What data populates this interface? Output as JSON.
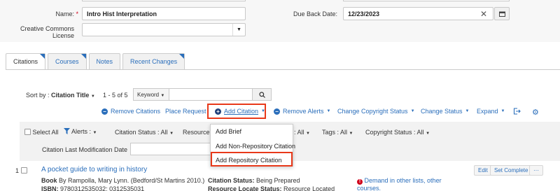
{
  "form": {
    "name_label": "Name:",
    "required_mark": "*",
    "name_value": "Intro Hist Interpretation",
    "cc_label_line1": "Creative Commons",
    "cc_label_line2": "License",
    "cc_value": "",
    "due_label": "Due Back Date:",
    "due_value": "12/23/2023"
  },
  "tabs": [
    {
      "label": "Citations"
    },
    {
      "label": "Courses"
    },
    {
      "label": "Notes"
    },
    {
      "label": "Recent Changes"
    }
  ],
  "sort": {
    "label": "Sort by :",
    "value": "Citation Title",
    "range": "1 - 5 of 5",
    "search_scope": "Keyword",
    "search_placeholder": ""
  },
  "toolbar": {
    "remove_citations": "Remove Citations",
    "place_request": "Place Request",
    "add_citation": "Add Citation",
    "remove_alerts": "Remove Alerts",
    "change_copyright_status": "Change Copyright Status",
    "change_status": "Change Status",
    "expand": "Expand"
  },
  "filters": {
    "select_all": "Select All",
    "alerts": "Alerts :",
    "citation_status": "Citation Status : All",
    "resource_prefix": "Resource L",
    "all_suffix": ": All",
    "tags": "Tags : All",
    "copyright_status": "Copyright Status : All",
    "last_modification": "Citation Last Modification Date"
  },
  "add_menu": {
    "items": [
      "Add Brief",
      "Add Non-Repository Citation",
      "Add Repository Citation"
    ]
  },
  "result": {
    "index": "1",
    "title": "A pocket guide to writing in history",
    "type": "Book",
    "byline": "By Rampolla, Mary Lynn. (Bedford/St Martins 2010.)",
    "isbn_label": "ISBN:",
    "isbn_value": "9780312535032; 0312535031",
    "citation_status_label": "Citation Status:",
    "citation_status_value": "Being Prepared",
    "resource_status_label": "Resource Locate Status:",
    "resource_status_value": "Resource Located",
    "demand_line1": "Demand in other lists, other",
    "demand_line2": "courses.",
    "edit": "Edit",
    "set_complete": "Set Complete",
    "more": "···"
  },
  "colors": {
    "accent": "#2a6ebb",
    "highlight": "#e8391a",
    "alert": "#d0021b"
  }
}
